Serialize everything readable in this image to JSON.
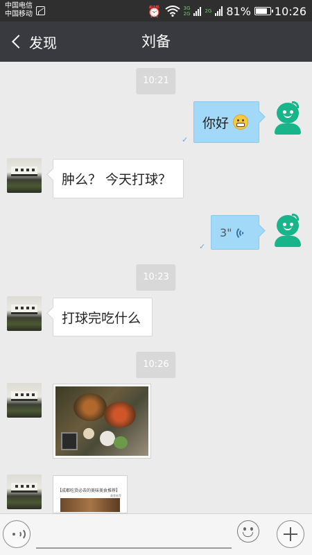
{
  "status_bar": {
    "carrier_1": "中国电信",
    "carrier_2": "中国移动",
    "net_3g": "3G",
    "net_2g_a": "2G",
    "net_2g_b": "2G",
    "battery_percent": "81%",
    "battery_level": 0.81,
    "time": "10:26",
    "icons": [
      "image-icon",
      "alarm-icon",
      "wifi-icon",
      "signal-icon",
      "battery-icon"
    ]
  },
  "title_bar": {
    "back_label": "发现",
    "title": "刘备"
  },
  "messages": [
    {
      "type": "timestamp",
      "text": "10:21"
    },
    {
      "type": "text",
      "side": "out",
      "text": "你好",
      "emoji": "grinning-emoji"
    },
    {
      "type": "text",
      "side": "in",
      "text": "肿么？ 今天打球？"
    },
    {
      "type": "voice",
      "side": "out",
      "duration": "3\""
    },
    {
      "type": "timestamp",
      "text": "10:23"
    },
    {
      "type": "text",
      "side": "in",
      "text": "打球完吃什么"
    },
    {
      "type": "timestamp",
      "text": "10:26"
    },
    {
      "type": "image",
      "side": "in",
      "subject": "food-photo"
    },
    {
      "type": "article",
      "side": "in",
      "title": "【成都吃货必去的美味美食推荐】",
      "subtitle": "美食推荐"
    }
  ],
  "input_bar": {
    "voice_toggle": "voice-toggle-icon",
    "emoji": "emoji-icon",
    "more": "plus-icon"
  },
  "colors": {
    "status_bar_bg": "#2f2f2f",
    "title_bar_bg": "#393a3f",
    "chat_bg": "#ebebeb",
    "outgoing_bubble": "#a2d9f8",
    "incoming_bubble": "#ffffff",
    "bot_avatar": "#18b48a"
  }
}
